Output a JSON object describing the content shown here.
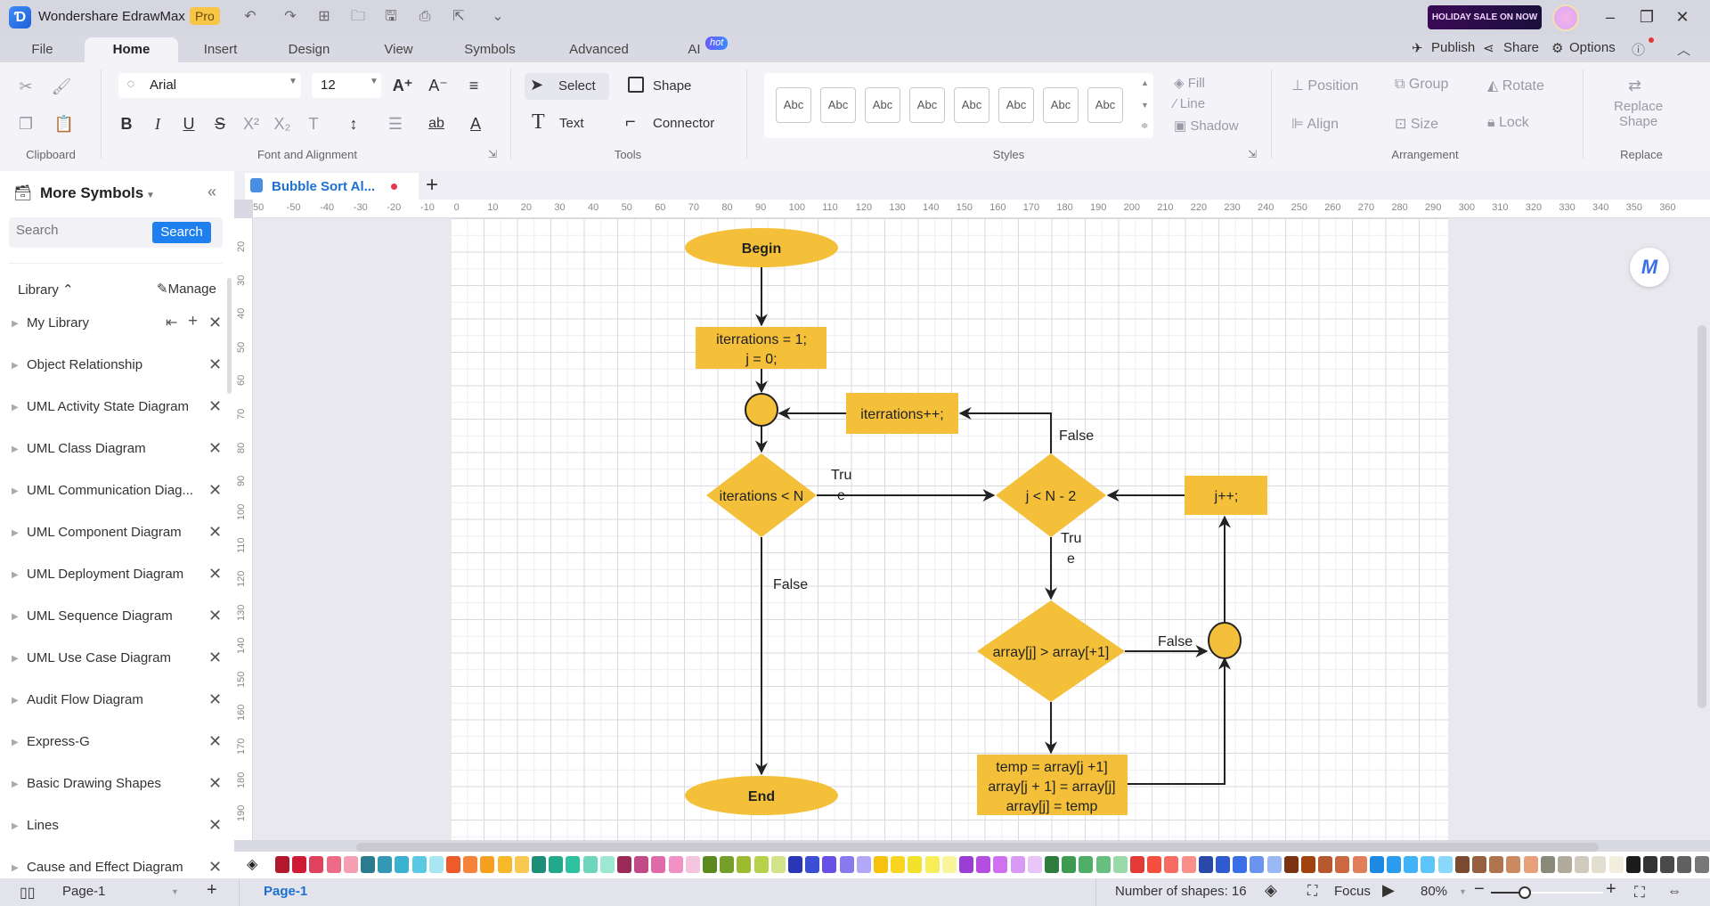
{
  "app": {
    "title": "Wondershare EdrawMax",
    "badge": "Pro",
    "sale_banner": "HOLIDAY SALE ON NOW"
  },
  "menu_tabs": [
    {
      "label": "File"
    },
    {
      "label": "Home"
    },
    {
      "label": "Insert"
    },
    {
      "label": "Design"
    },
    {
      "label": "View"
    },
    {
      "label": "Symbols"
    },
    {
      "label": "Advanced"
    },
    {
      "label": "AI"
    }
  ],
  "ai_badge": "hot",
  "top_actions": {
    "publish": "Publish",
    "share": "Share",
    "options": "Options"
  },
  "ribbon": {
    "font_name": "Arial",
    "font_size": "12",
    "select": "Select",
    "shape": "Shape",
    "text": "Text",
    "connector": "Connector",
    "style_sample": "Abc",
    "fill": "Fill",
    "line": "Line",
    "shadow": "Shadow",
    "position": "Position",
    "group": "Group",
    "rotate": "Rotate",
    "align": "Align",
    "size": "Size",
    "lock": "Lock",
    "replace_shape_1": "Replace",
    "replace_shape_2": "Shape",
    "groups": {
      "clipboard": "Clipboard",
      "font": "Font and Alignment",
      "tools": "Tools",
      "styles": "Styles",
      "arrangement": "Arrangement",
      "replace": "Replace"
    }
  },
  "sidebar": {
    "title": "More Symbols",
    "search_placeholder": "Search",
    "search_button": "Search",
    "library_label": "Library",
    "manage_label": "Manage",
    "libraries": [
      "My Library",
      "Object Relationship",
      "UML Activity State Diagram",
      "UML Class Diagram",
      "UML Communication Diag...",
      "UML Component Diagram",
      "UML Deployment Diagram",
      "UML Sequence Diagram",
      "UML Use Case Diagram",
      "Audit Flow Diagram",
      "Express-G",
      "Basic Drawing Shapes",
      "Lines",
      "Cause and Effect Diagram"
    ]
  },
  "document": {
    "tab_title": "Bubble Sort Al...",
    "unsaved": true
  },
  "rulers": {
    "horizontal": [
      "50",
      "-50",
      "-40",
      "-30",
      "-20",
      "-10",
      "0",
      "10",
      "20",
      "30",
      "40",
      "50",
      "60",
      "70",
      "80",
      "90",
      "100",
      "110",
      "120",
      "130",
      "140",
      "150",
      "160",
      "170",
      "180",
      "190",
      "200",
      "210",
      "220",
      "230",
      "240",
      "250",
      "260",
      "270",
      "280",
      "290",
      "300",
      "310",
      "320",
      "330",
      "340",
      "350",
      "360"
    ],
    "vertical": [
      "20",
      "30",
      "40",
      "50",
      "60",
      "70",
      "80",
      "90",
      "100",
      "110",
      "120",
      "130",
      "140",
      "150",
      "160",
      "170",
      "180",
      "190"
    ]
  },
  "diagram": {
    "fill_color": "#f4c03a",
    "begin": "Begin",
    "init_line1": "iterrations = 1;",
    "init_line2": "j = 0;",
    "iter_inc": "iterrations++;",
    "cond_outer": "iterations < N",
    "cond_inner": "j < N - 2",
    "j_inc": "j++;",
    "cond_compare": "array[j] > array[+1]",
    "swap_line1": "temp = array[j +1]",
    "swap_line2": "array[j + 1] = array[j]",
    "swap_line3": "array[j] = temp",
    "end": "End",
    "label_true_a1": "Tru",
    "label_true_a2": "e",
    "label_false_outer": "False",
    "label_false_inner": "False",
    "label_true_b1": "Tru",
    "label_true_b2": "e",
    "label_false_compare": "False"
  },
  "palette": [
    "#b3172b",
    "#cf1a36",
    "#e0415d",
    "#ef6a86",
    "#f5a0b2",
    "#2a7c8e",
    "#3398b5",
    "#3ab3d1",
    "#5bc9e3",
    "#a8e6f2",
    "#ef5a2a",
    "#f5843a",
    "#f7a020",
    "#f7b928",
    "#f9c850",
    "#1d8f78",
    "#22a98b",
    "#2dc2a0",
    "#6dd6bd",
    "#9de8d3",
    "#9c2a58",
    "#c24a86",
    "#e06aa8",
    "#f291c6",
    "#f5c4de",
    "#5a8a1e",
    "#74a02a",
    "#9cbb2e",
    "#b7d14a",
    "#d3e38a",
    "#2a36b8",
    "#3c4ed6",
    "#6a4fe6",
    "#8a7af0",
    "#b3a8f5",
    "#f7c20a",
    "#f9d420",
    "#f2e22a",
    "#f7ee5a",
    "#f9f59a",
    "#9a3ed6",
    "#b54ee0",
    "#d070f0",
    "#d89af5",
    "#e8c6f8",
    "#2e7d3e",
    "#3f9a52",
    "#4ead66",
    "#68c080",
    "#9cd9a8",
    "#e53935",
    "#f44f3f",
    "#f76b62",
    "#f98f88",
    "#2948a8",
    "#2f5ad0",
    "#3a6fe8",
    "#6a94f0",
    "#9ab8f5",
    "#7a3212",
    "#a2420e",
    "#b8562e",
    "#cc6840",
    "#e07f5a",
    "#1e88e5",
    "#2a9df0",
    "#40b2f7",
    "#5cc6fa",
    "#8ad9fc",
    "#7a4a30",
    "#96603e",
    "#b07450",
    "#cc8a60",
    "#e8a07a",
    "#8a8a7a",
    "#b0ab9a",
    "#cfcabb",
    "#e3dfd0",
    "#f2eedd",
    "#1c1c1c",
    "#333333",
    "#4a4a4a",
    "#606060",
    "#787878",
    "#a0a0a0",
    "#bcbcbc",
    "#d4d4d4",
    "#e6e6e6",
    "#f4f4f4"
  ],
  "status": {
    "page_selector": "Page-1",
    "page_tab": "Page-1",
    "shape_count": "Number of shapes: 16",
    "focus": "Focus",
    "zoom": "80%",
    "zoom_fraction": 0.3
  }
}
